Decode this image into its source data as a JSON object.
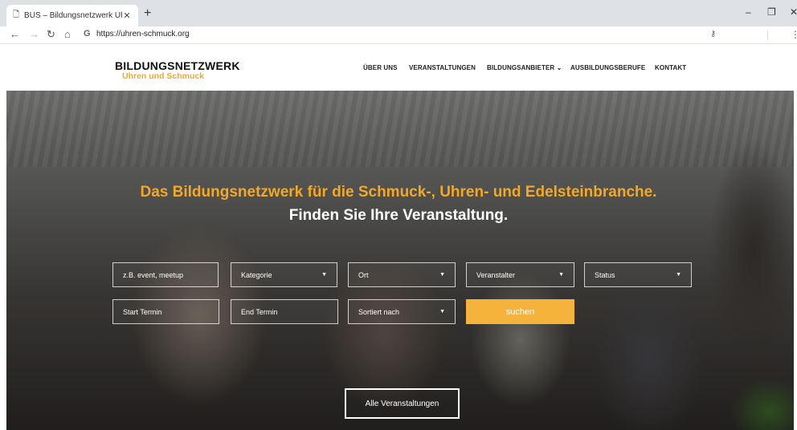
{
  "browser": {
    "tab_title": "BUS – Bildungsnetzwerk Uhren u",
    "url": "https://uhren-schmuck.org"
  },
  "site": {
    "logo_title": "BILDUNGSNETZWERK",
    "logo_subtitle": "Uhren und Schmuck",
    "nav": [
      {
        "label": "ÜBER UNS"
      },
      {
        "label": "VERANSTALTUNGEN"
      },
      {
        "label": "BILDUNGSANBIETER ⌄"
      },
      {
        "label": "AUSBILDUNGSBERUFE"
      },
      {
        "label": "KONTAKT"
      }
    ]
  },
  "hero": {
    "headline": "Das Bildungsnetzwerk für die Schmuck-, Uhren- und Edelsteinbranche.",
    "subheadline": "Finden Sie Ihre Veranstaltung.",
    "search": {
      "keyword_placeholder": "z.B. event, meetup",
      "category": "Kategorie",
      "location": "Ort",
      "organizer": "Veranstalter",
      "status": "Status",
      "start_date": "Start Termin",
      "end_date": "End Termin",
      "sort": "Sortiert nach",
      "submit": "suchen"
    },
    "all_events_button": "Alle Veranstaltungen"
  },
  "colors": {
    "accent": "#f3a826",
    "button": "#f6b33b"
  }
}
